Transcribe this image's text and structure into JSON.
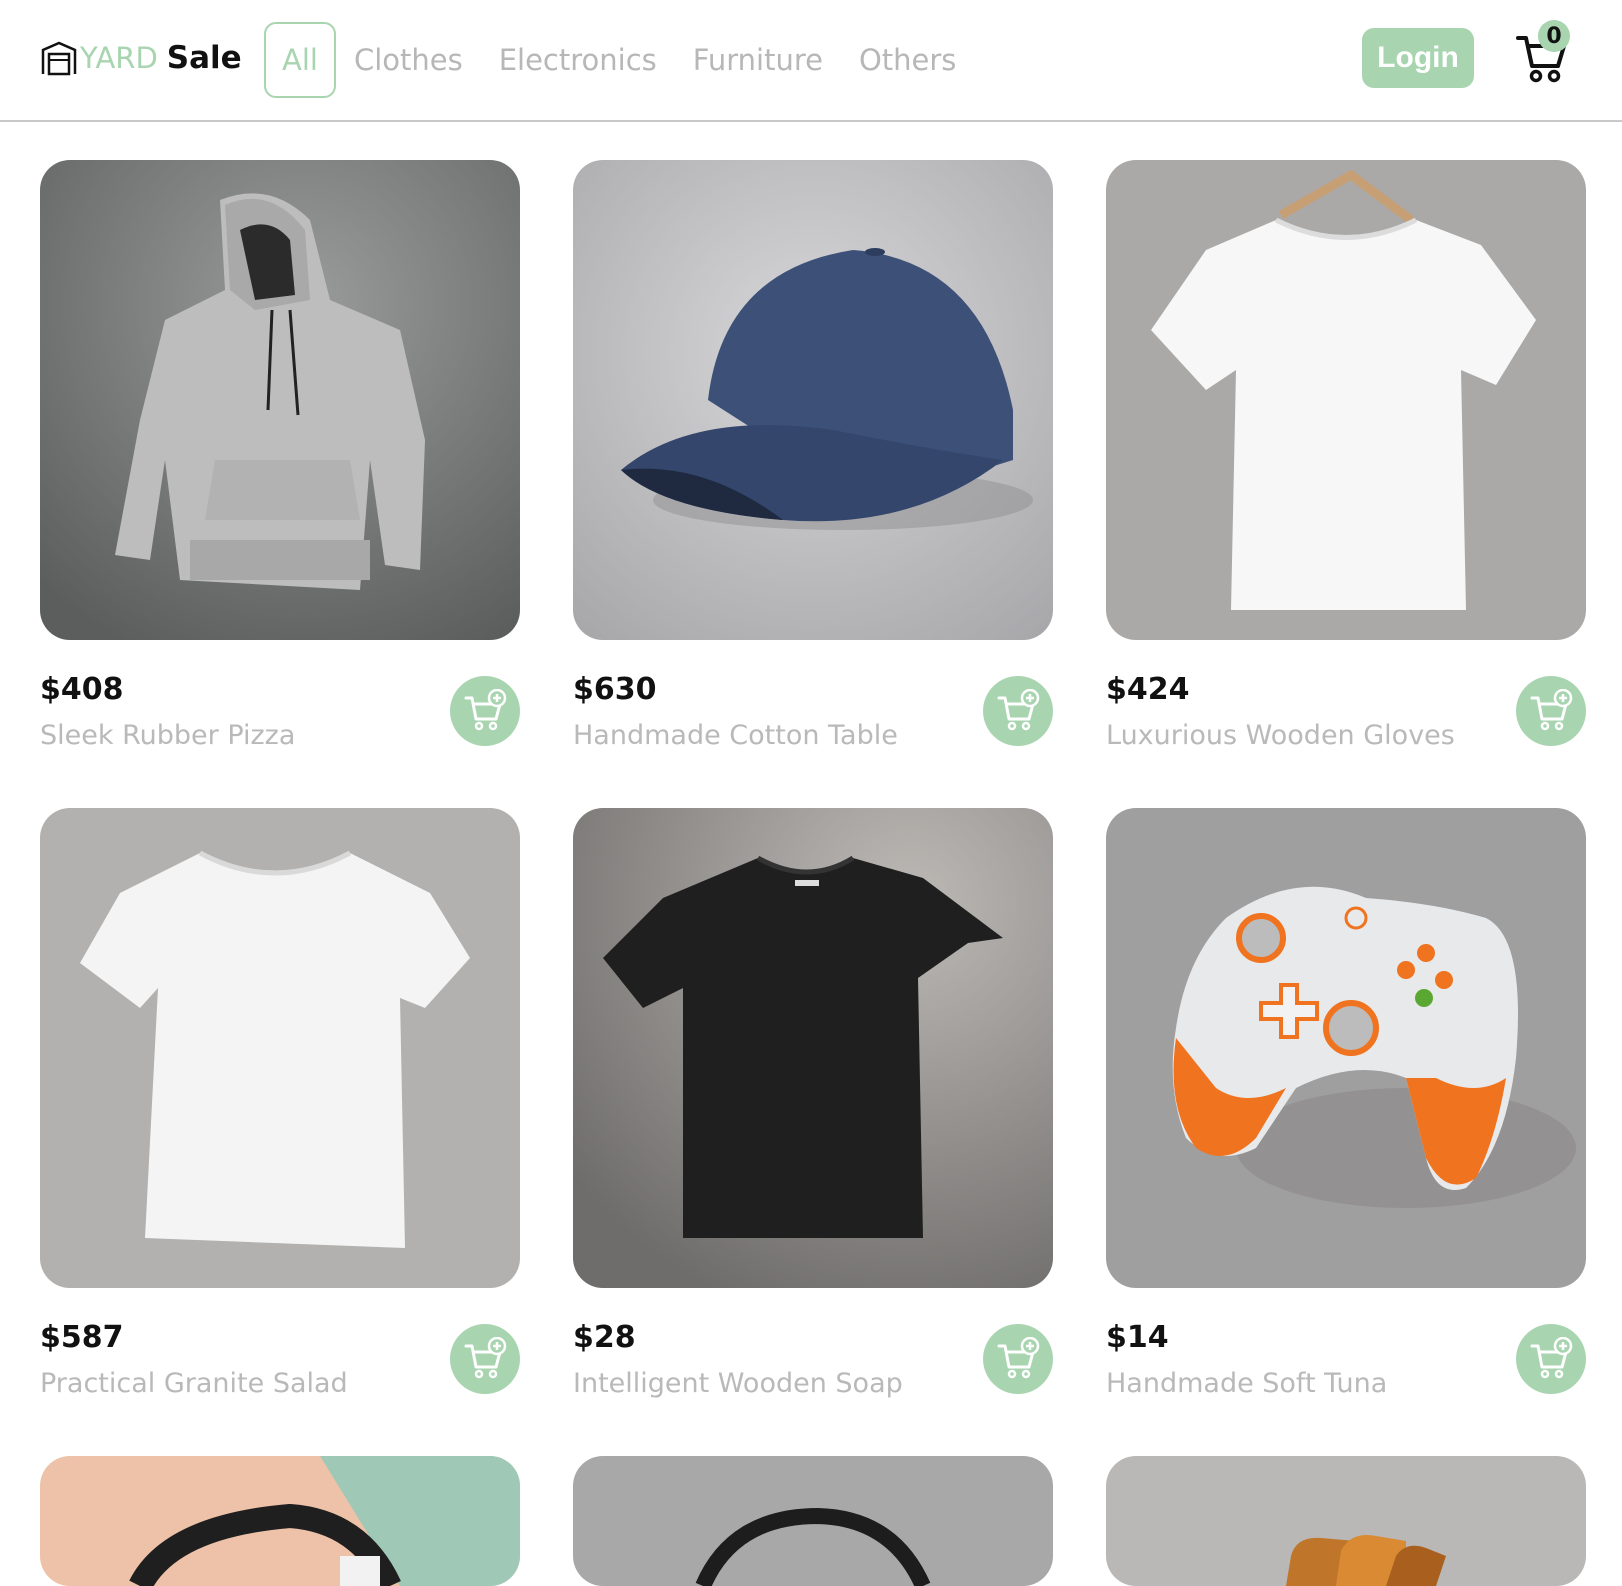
{
  "header": {
    "brand": {
      "yard": "YARD",
      "sale": "Sale",
      "icon": "garage-icon"
    },
    "nav": [
      {
        "label": "All",
        "active": true
      },
      {
        "label": "Clothes",
        "active": false
      },
      {
        "label": "Electronics",
        "active": false
      },
      {
        "label": "Furniture",
        "active": false
      },
      {
        "label": "Others",
        "active": false
      }
    ],
    "login_label": "Login",
    "cart_count": "0",
    "cart_icon": "shopping-cart-icon"
  },
  "colors": {
    "accent": "#a8d5b0",
    "muted_text": "#b9b9b9",
    "text": "#111111"
  },
  "products": [
    {
      "price": "$408",
      "name": "Sleek Rubber Pizza",
      "image": "gray hoodie"
    },
    {
      "price": "$630",
      "name": "Handmade Cotton Table",
      "image": "navy baseball cap"
    },
    {
      "price": "$424",
      "name": "Luxurious Wooden Gloves",
      "image": "white t-shirt on hanger"
    },
    {
      "price": "$587",
      "name": "Practical Granite Salad",
      "image": "white t-shirt"
    },
    {
      "price": "$28",
      "name": "Intelligent Wooden Soap",
      "image": "black t-shirt"
    },
    {
      "price": "$14",
      "name": "Handmade Soft Tuna",
      "image": "white and orange game controller"
    },
    {
      "price": "",
      "name": "",
      "image": "headphones on peach background"
    },
    {
      "price": "",
      "name": "",
      "image": "black headphones"
    },
    {
      "price": "",
      "name": "",
      "image": "toast in toaster"
    }
  ]
}
